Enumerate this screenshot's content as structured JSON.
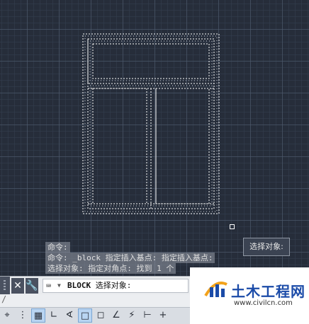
{
  "canvas": {
    "tooltip": "选择对象:",
    "history": [
      "命令:",
      "命令: _block 指定插入基点: 指定插入基点:",
      "选择对象: 指定对角点: 找到 1 个"
    ]
  },
  "command_line": {
    "close_icon": "close-icon",
    "settings_icon": "wrench-icon",
    "input_icon": "command-icon",
    "command_name": "BLOCK",
    "prompt": "选择对象:"
  },
  "status_bar": {
    "icons": [
      "snap-icon",
      "grid-dots-icon",
      "grid-icon",
      "ortho-icon",
      "polar-icon",
      "osnap-icon",
      "3d-osnap-icon",
      "otrack-icon",
      "dynamic-ucs-icon",
      "lineweight-icon",
      "plus-icon"
    ]
  },
  "watermark": {
    "name": "土木工程网",
    "url": "www.civilcn.com"
  },
  "colors": {
    "canvas_bg": "#262d3a",
    "selection": "#ffffff",
    "brand": "#1b4ba8"
  }
}
